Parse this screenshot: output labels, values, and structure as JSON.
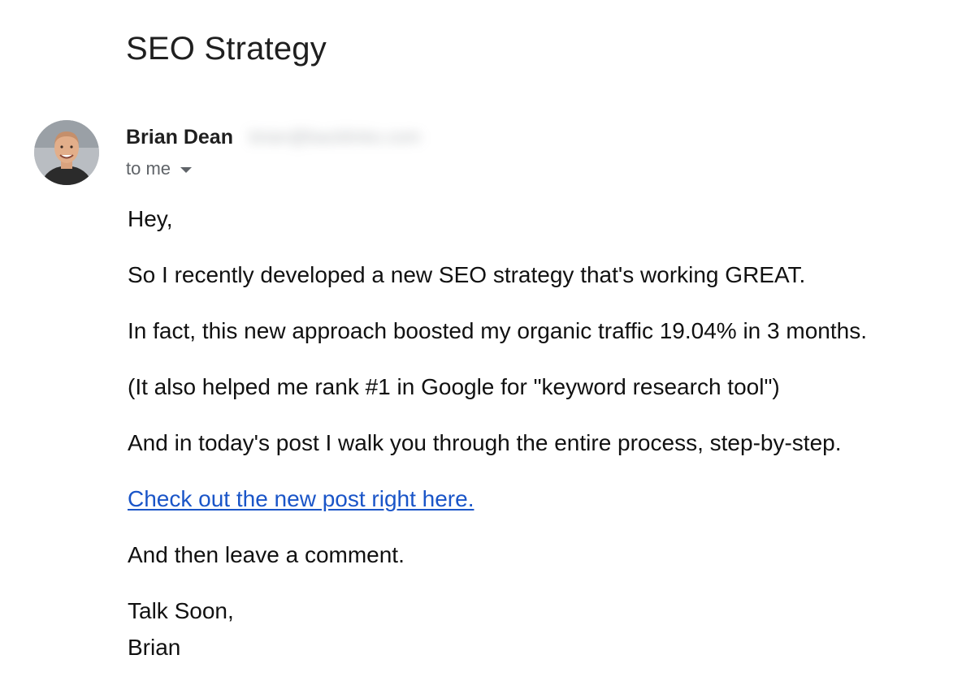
{
  "email": {
    "subject": "SEO Strategy",
    "sender": {
      "name": "Brian Dean",
      "email_obscured": "brian@backlinko.com"
    },
    "recipient_label": "to me",
    "icons": {
      "avatar": "profile-photo",
      "recipient_caret": "caret-down-icon"
    },
    "body": {
      "greeting": "Hey,",
      "line_1": "So I recently developed a new SEO strategy that's working GREAT.",
      "line_2": "In fact, this new approach boosted my organic traffic 19.04% in 3 months.",
      "line_3": "(It also helped me rank #1 in Google for \"keyword research tool\")",
      "line_4": "And in today's post I walk you through the entire process, step-by-step.",
      "link_text": "Check out the new post right here.",
      "line_5": "And then leave a comment.",
      "signoff": "Talk Soon,",
      "signature": "Brian"
    },
    "colors": {
      "link": "#1a55c8",
      "text": "#111111",
      "muted": "#5f6368"
    }
  }
}
